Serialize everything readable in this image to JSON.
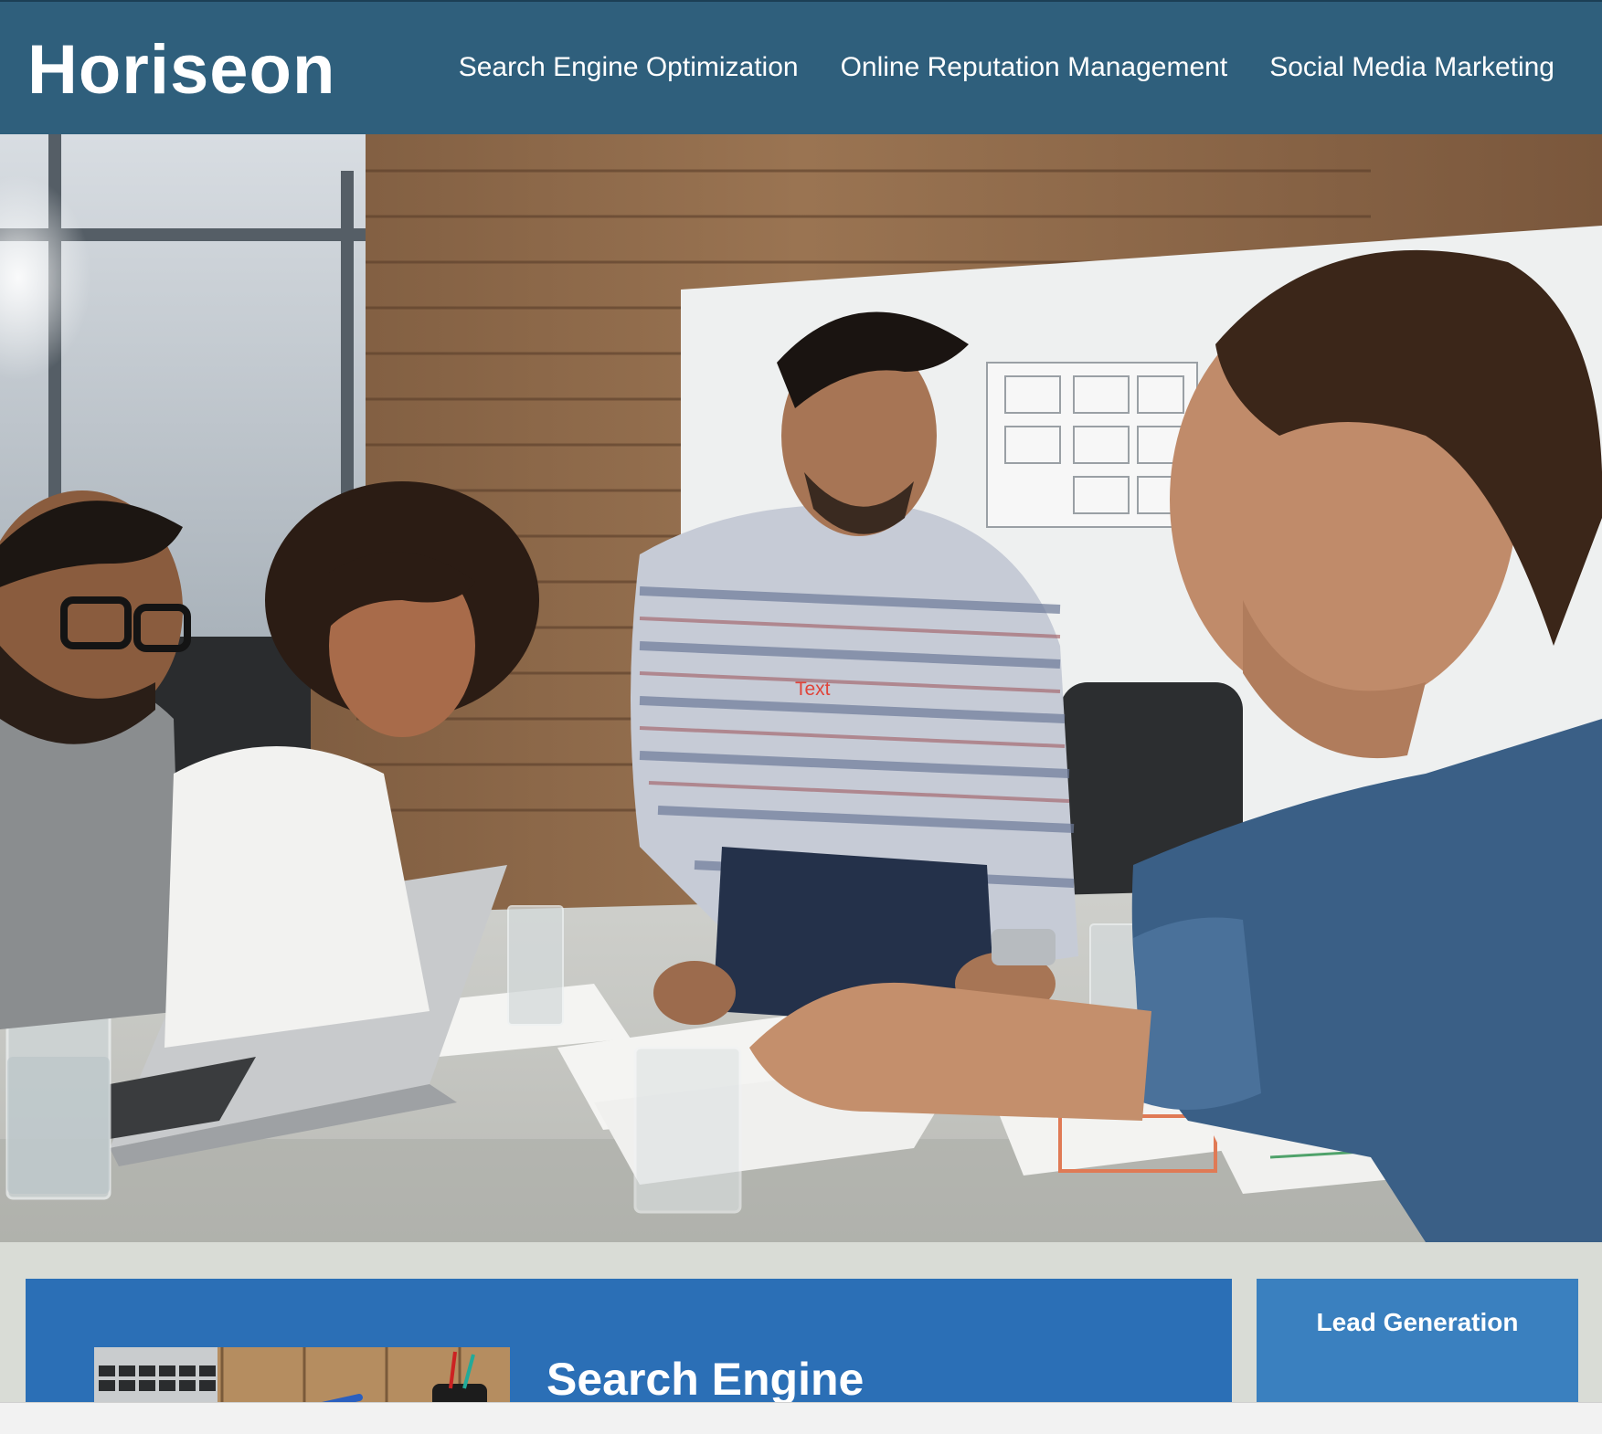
{
  "header": {
    "logo": "Horiseon",
    "nav": [
      "Search Engine Optimization",
      "Online Reputation Management",
      "Social Media Marketing"
    ]
  },
  "hero": {
    "overlay_text": "Text"
  },
  "content": {
    "main_title": "Search Engine",
    "side_title": "Lead Generation"
  },
  "colors": {
    "header_bg": "#2f5f7c",
    "main_card_bg": "#2b6fb6",
    "side_card_bg": "#3a80bf",
    "page_bg": "#d9dcd6"
  }
}
